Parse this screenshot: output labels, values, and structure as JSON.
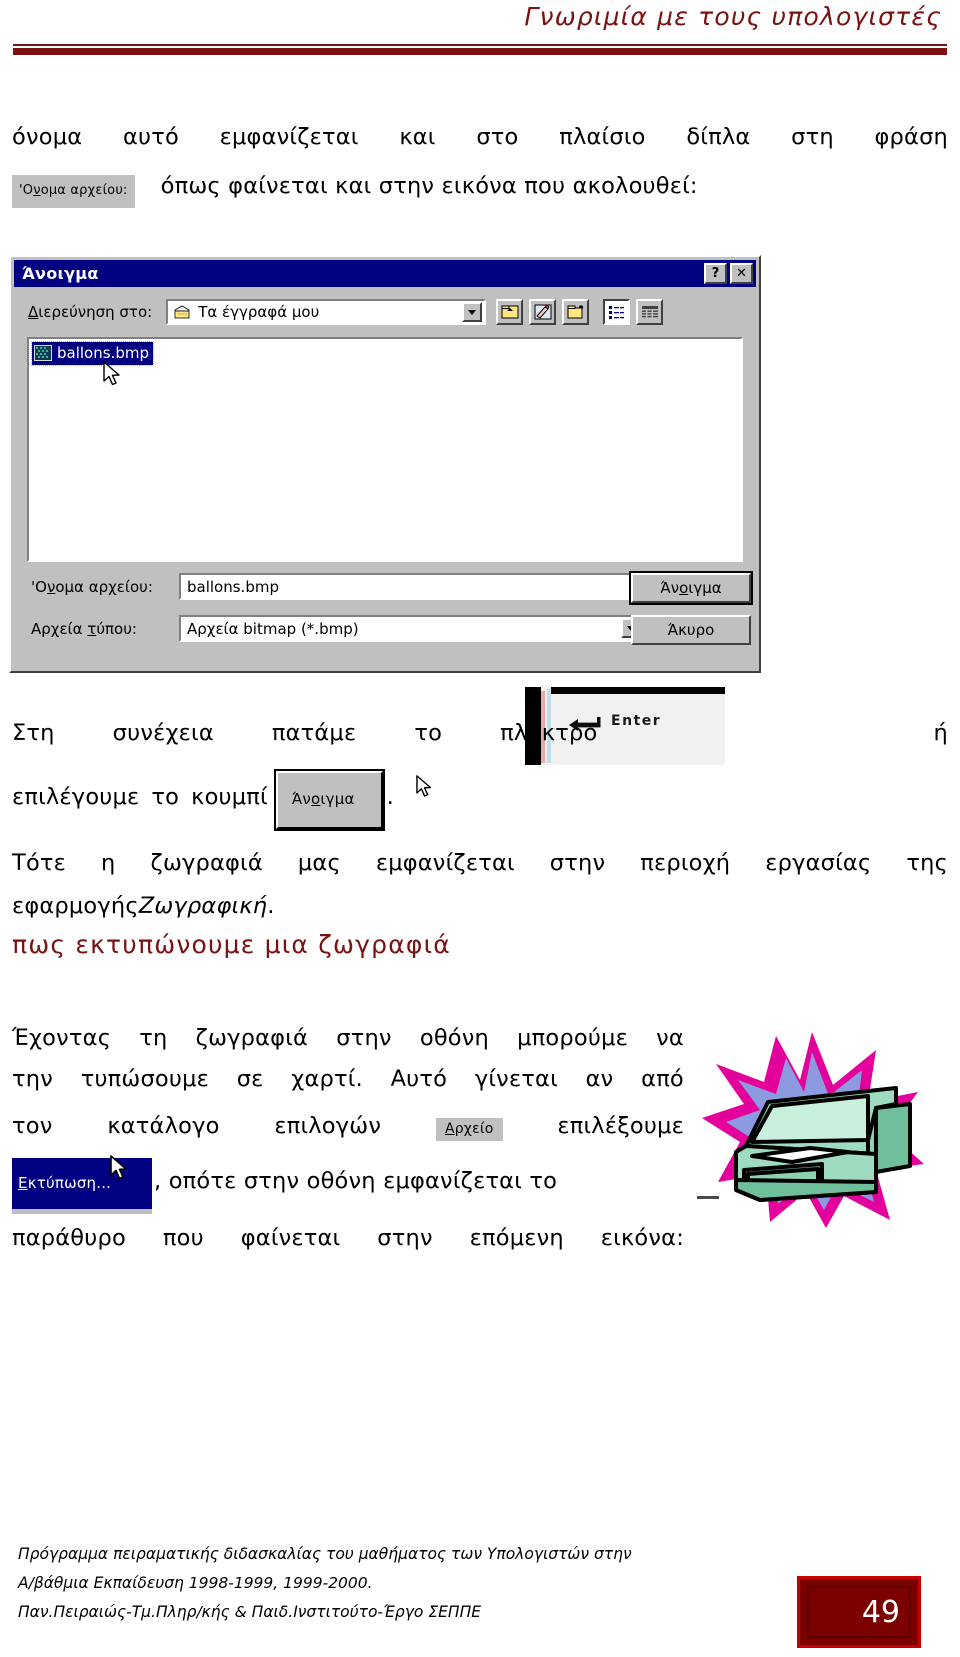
{
  "header": {
    "title": "Γνωριμία με τους υπολογιστές"
  },
  "intro_paragraph": {
    "line1_text": "όνομα αυτό εμφανίζεται και στο πλαίσιο δίπλα στη φράση",
    "line1_words": [
      "όνομα",
      "αυτό",
      "εμφανίζεται",
      "και",
      "στο",
      "πλαίσιο",
      "δίπλα",
      "στη",
      "φράση"
    ],
    "inline_chip_filename_label": "Όνομα αρχείου:",
    "line2_text": "όπως φαίνεται και στην εικόνα που ακολουθεί:"
  },
  "open_dialog": {
    "title": "Άνοιγμα",
    "help_button": "?",
    "close_button": "✕",
    "look_in_label": "Διερεύνηση στο:",
    "look_in_value": "Τα έγγραφά μου",
    "toolbar_icons": [
      "up-one-level-icon",
      "favorites-icon",
      "new-folder-icon",
      "list-view-icon",
      "details-view-icon"
    ],
    "file_list": [
      {
        "name": "ballons.bmp",
        "selected": true
      }
    ],
    "file_name_label": "Όνομα αρχείου:",
    "file_name_value": "ballons.bmp",
    "file_type_label": "Αρχεία τύπου:",
    "file_type_value": "Αρχεία bitmap (*.bmp)",
    "open_button": "Άνοιγμα",
    "cancel_button": "Άκυρο"
  },
  "enter_paragraph": {
    "line1_words": [
      "Στη",
      "συνέχεια",
      "πατάμε",
      "το",
      "πλήκτρο"
    ],
    "line1_tail": "ή",
    "enter_key_label": "Enter",
    "line2_words": [
      "επιλέγουμε",
      "το",
      "κουμπί"
    ],
    "open_button_chip": "Άνοιγμα",
    "line2_period": ".",
    "line3_words": [
      "Τότε",
      "η",
      "ζωγραφιά",
      "μας",
      "εμφανίζεται",
      "στην",
      "περιοχή",
      "εργασίας",
      "της"
    ],
    "line4_prefix": "εφαρμογής ",
    "line4_italic": "Ζωγραφική",
    "line4_suffix": "."
  },
  "section_heading": {
    "text": "πως εκτυπώνουμε μια ζωγραφιά",
    "color": "#7b1113"
  },
  "print_paragraph": {
    "line1_words": [
      "Έχοντας",
      "τη",
      "ζωγραφιά",
      "στην",
      "οθόνη",
      "μπορούμε",
      "να"
    ],
    "line2_words": [
      "την",
      "τυπώσουμε",
      "σε",
      "χαρτί.",
      "Αυτό",
      "γίνεται",
      "αν",
      "από"
    ],
    "line3_words": [
      "τον",
      "κατάλογο",
      "επιλογών"
    ],
    "menu_chip_arxeio": "Αρχείο",
    "line3_tail": "επιλέξουμε",
    "menu_chip_print": "Εκτύπωση...",
    "line4_text": ", οπότε στην οθόνη εμφανίζεται το",
    "line5_words": [
      "παράθυρο",
      "που",
      "φαίνεται",
      "στην",
      "επόμενη",
      "εικόνα:"
    ]
  },
  "clipart": {
    "name": "printer-clipart",
    "description": "printer with starburst",
    "colors": {
      "printer_body": "#9fdbc0",
      "printer_light": "#c9efdd",
      "printer_dark": "#6fbf9a",
      "burst_magenta": "#e3009b",
      "burst_blue": "#8c9ae0",
      "outline": "#000000"
    }
  },
  "footer": {
    "line1": "Πρόγραμμα πειραματικής διδασκαλίας του μαθήματος των Υπολογιστών στην",
    "line2": "Α/βάθμια Εκπαίδευση 1998-1999, 1999-2000.",
    "line3": "Παν.Πειραιώς-Τμ.Πληρ/κής & Παιδ.Ινστιτούτο-Έργο ΣΕΠΠΕ",
    "page_number": "49",
    "badge_bg": "#7b0000",
    "badge_border": "#c80000"
  }
}
